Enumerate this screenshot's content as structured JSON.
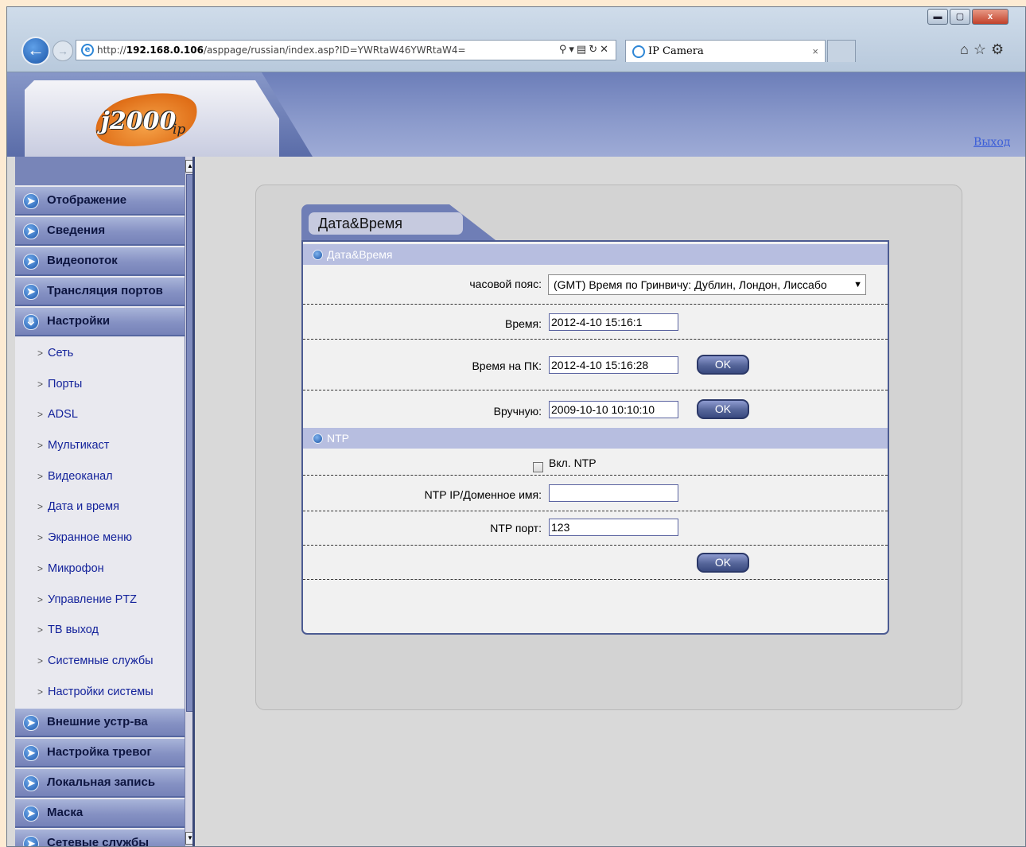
{
  "browser": {
    "url_prefix": "http://",
    "url_host": "192.168.0.106",
    "url_rest": "/asppage/russian/index.asp?ID=YWRtaW46YWRtaW4=",
    "tab_title": "IP Camera",
    "tab_close": "×",
    "window_buttons": {
      "minimize": "▬",
      "maximize": "▢",
      "close": "x"
    }
  },
  "banner": {
    "logo_text": "j2000",
    "logo_sub": "ip",
    "logout_label": "Выход"
  },
  "sidebar": {
    "items_top": [
      {
        "label": "Отображение"
      },
      {
        "label": "Сведения"
      },
      {
        "label": "Видеопоток"
      },
      {
        "label": "Трансляция портов"
      },
      {
        "label": "Настройки"
      }
    ],
    "subitems": [
      {
        "label": "Сеть"
      },
      {
        "label": "Порты"
      },
      {
        "label": "ADSL"
      },
      {
        "label": "Мультикаст"
      },
      {
        "label": "Видеоканал"
      },
      {
        "label": "Дата и время"
      },
      {
        "label": "Экранное меню"
      },
      {
        "label": "Микрофон"
      },
      {
        "label": "Управление PTZ"
      },
      {
        "label": "ТВ выход"
      },
      {
        "label": "Системные службы"
      },
      {
        "label": "Настройки системы"
      }
    ],
    "items_bottom": [
      {
        "label": "Внешние устр-ва"
      },
      {
        "label": "Настройка тревог"
      },
      {
        "label": "Локальная запись"
      },
      {
        "label": "Маска"
      },
      {
        "label": "Сетевые службы"
      }
    ]
  },
  "form": {
    "tab_title": "Дата&Время",
    "section_datetime": "Дата&Время",
    "timezone_label": "часовой пояс:",
    "timezone_value": "(GMT) Время по Гринвичу: Дублин, Лондон, Лиссабо",
    "time_label": "Время:",
    "time_value": "2012-4-10 15:16:1",
    "pc_time_label": "Время на ПК:",
    "pc_time_value": "2012-4-10 15:16:28",
    "manual_label": "Вручную:",
    "manual_value": "2009-10-10 10:10:10",
    "ok_label": "OK",
    "section_ntp": "NTP",
    "ntp_enable_label": "Вкл. NTP",
    "ntp_enabled": false,
    "ntp_host_label": "NTP IP/Доменное имя:",
    "ntp_host_value": "",
    "ntp_port_label": "NTP порт:",
    "ntp_port_value": "123"
  }
}
